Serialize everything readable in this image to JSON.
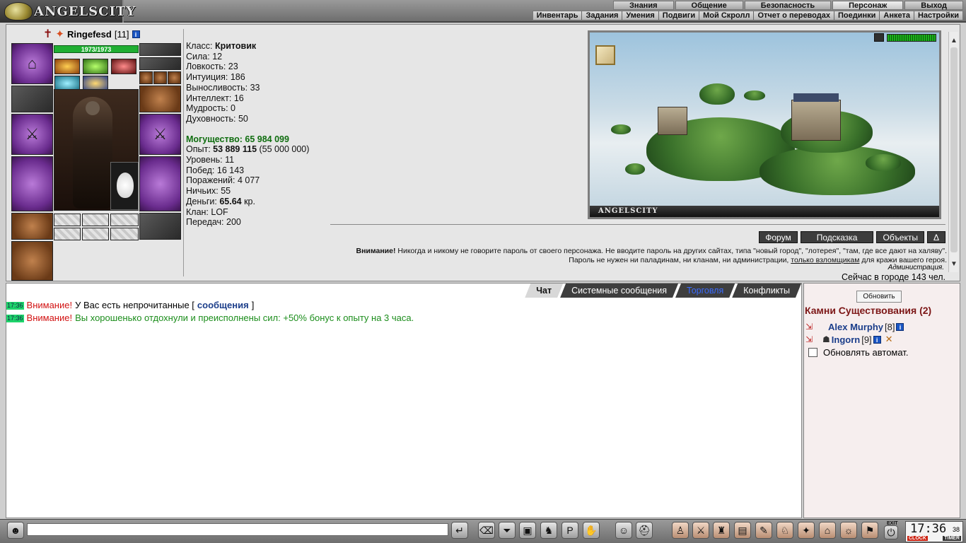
{
  "app": {
    "logo_text": "ANGELSCITY"
  },
  "menu_main": [
    "Знания",
    "Общение",
    "Безопасность",
    "Персонаж",
    "Выход"
  ],
  "menu_sub": [
    "Инвентарь",
    "Задания",
    "Умения",
    "Подвиги",
    "Мой Скролл",
    "Отчет о переводах",
    "Поединки",
    "Анкета",
    "Настройки"
  ],
  "character": {
    "name": "Ringefesd",
    "level": "[11]",
    "info_icon": "i",
    "hp": "1973/1973"
  },
  "stats": {
    "class_label": "Класс: ",
    "class_value": "Критовик",
    "lines": [
      "Сила: 12",
      "Ловкость: 23",
      "Интуиция: 186",
      "Выносливость: 33",
      "Интеллект: 16",
      "Мудрость: 0",
      "Духовность: 50"
    ],
    "power_label": "Могущество: 65 984 099",
    "exp_label": "Опыт: ",
    "exp_value": "53 889 115",
    "exp_next": " (55 000 000)",
    "lines2": [
      "Уровень: 11",
      "Побед: 16 143",
      "Поражений: 4 077",
      "Ничьих: 55"
    ],
    "money_label": "Деньги: ",
    "money_value": "65.64",
    "money_unit": " кр.",
    "lines3": [
      "Клан: LOF",
      "Передач: 200"
    ]
  },
  "location": {
    "label": "ANGELSCITY",
    "buttons": [
      "Форум",
      "Подсказка",
      "Объекты",
      "Δ"
    ]
  },
  "warning": {
    "bold": "Внимание!",
    "text1": " Никогда и никому не говорите пароль от своего персонажа. Не вводите пароль на других сайтах, типа \"новый город\", \"лотерея\", \"там, где все дают на халяву\". Пароль не нужен ни паладинам, ни кланам, ни администрации, ",
    "underline": "только взломщикам",
    "text2": " для кражи вашего героя.",
    "sign": "Администрация.",
    "online": "Сейчас в городе 143 чел."
  },
  "chat": {
    "tabs": [
      "Чат",
      "Системные сообщения",
      "Торговля",
      "Конфликты"
    ],
    "messages": [
      {
        "time": "17:36",
        "alert": "Внимание!",
        "text": " У Вас есть непрочитанные [",
        "link": "сообщения",
        "tail": "]"
      },
      {
        "time": "17:36",
        "alert": "Внимание!",
        "text": " Вы хорошенько отдохнули и преисполнены сил: +50% бонус к опыту на 3 часа."
      }
    ],
    "input_value": ""
  },
  "side": {
    "refresh": "Обновить",
    "title": "Камни Существования (2)",
    "players": [
      {
        "name": "Alex Murphy",
        "level": "[8]"
      },
      {
        "name": "Ingorn",
        "level": "[9]"
      }
    ],
    "auto_refresh": "Обновлять автомат."
  },
  "clock": {
    "time": "17:36",
    "seconds": "38",
    "label_clock": "CLOCK",
    "label_timer": "TIMER",
    "exit": "EXIT"
  },
  "colors": {
    "power": "#0f6d0f",
    "alert": "#d21212",
    "bonus": "#1b8d1b",
    "side_title": "#7c1616"
  }
}
